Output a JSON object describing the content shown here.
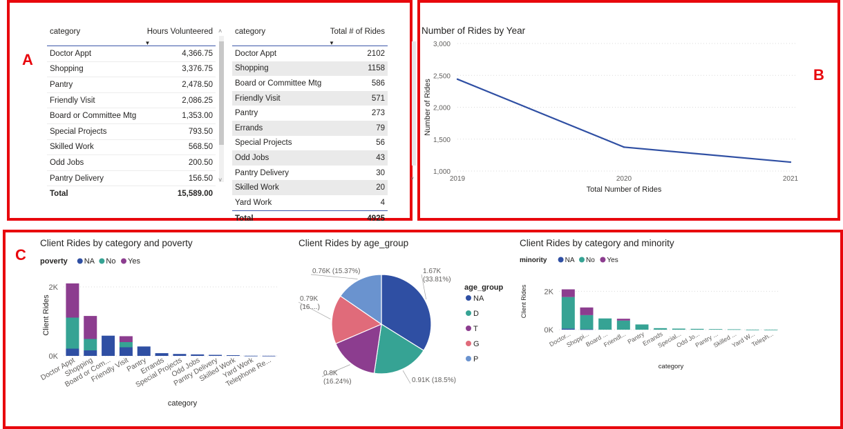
{
  "panels": {
    "a": {
      "letter": "A"
    },
    "b": {
      "letter": "B"
    },
    "c": {
      "letter": "C"
    }
  },
  "hours_table": {
    "col1": "category",
    "col2": "Hours Volunteered",
    "rows": [
      [
        "Doctor Appt",
        "4,366.75"
      ],
      [
        "Shopping",
        "3,376.75"
      ],
      [
        "Pantry",
        "2,478.50"
      ],
      [
        "Friendly Visit",
        "2,086.25"
      ],
      [
        "Board or Committee Mtg",
        "1,353.00"
      ],
      [
        "Special Projects",
        "793.50"
      ],
      [
        "Skilled Work",
        "568.50"
      ],
      [
        "Odd Jobs",
        "200.50"
      ],
      [
        "Pantry Delivery",
        "156.50"
      ]
    ],
    "total_label": "Total",
    "total_value": "15,589.00"
  },
  "rides_table": {
    "col1": "category",
    "col2": "Total # of Rides",
    "rows": [
      [
        "Doctor Appt",
        "2102"
      ],
      [
        "Shopping",
        "1158"
      ],
      [
        "Board or Committee Mtg",
        "586"
      ],
      [
        "Friendly Visit",
        "571"
      ],
      [
        "Pantry",
        "273"
      ],
      [
        "Errands",
        "79"
      ],
      [
        "Special Projects",
        "56"
      ],
      [
        "Odd Jobs",
        "43"
      ],
      [
        "Pantry Delivery",
        "30"
      ],
      [
        "Skilled Work",
        "20"
      ],
      [
        "Yard Work",
        "4"
      ]
    ],
    "total_label": "Total",
    "total_value": "4925"
  },
  "colors": {
    "frame": "#e8070d",
    "NA": "#2f4fa3",
    "No": "#36a394",
    "Yes": "#8c3d8f",
    "T": "#8c3d8f",
    "G": "#e06b7a",
    "P": "#6a93cf"
  },
  "chart_data": [
    {
      "id": "rides_by_year",
      "type": "line",
      "title": "Number of Rides by Year",
      "xlabel": "Total Number of Rides",
      "ylabel": "Number of Rides",
      "x": [
        "2019",
        "2020",
        "2021"
      ],
      "values": [
        2440,
        1375,
        1140
      ],
      "ylim": [
        1000,
        3000
      ],
      "yticks": [
        1000,
        1500,
        2000,
        2500,
        3000
      ],
      "ytick_labels": [
        "1,000",
        "1,500",
        "2,000",
        "2,500",
        "3,000"
      ],
      "color": "#2f4fa3",
      "grid": true
    },
    {
      "id": "rides_by_poverty",
      "type": "bar",
      "stacked": true,
      "title": "Client Rides by category and poverty",
      "legend_title": "poverty",
      "legend_position": "top-left",
      "xlabel": "category",
      "ylabel": "Client Rides",
      "categories": [
        "Doctor Appt",
        "Shopping",
        "Board or Com...",
        "Friendly Visit",
        "Pantry",
        "Errands",
        "Special Projects",
        "Odd Jobs",
        "Pantry Delivery",
        "Skilled Work",
        "Yard Work",
        "Telephone Re..."
      ],
      "series": [
        {
          "name": "NA",
          "values": [
            210,
            160,
            586,
            250,
            273,
            79,
            56,
            43,
            30,
            20,
            4,
            3
          ]
        },
        {
          "name": "No",
          "values": [
            900,
            330,
            0,
            150,
            0,
            0,
            0,
            0,
            0,
            0,
            0,
            0
          ]
        },
        {
          "name": "Yes",
          "values": [
            992,
            668,
            0,
            171,
            0,
            0,
            0,
            0,
            0,
            0,
            0,
            0
          ]
        }
      ],
      "ylim": [
        0,
        2200
      ],
      "yticks": [
        0,
        2000
      ],
      "ytick_labels": [
        "0K",
        "2K"
      ]
    },
    {
      "id": "rides_by_age_group",
      "type": "pie",
      "title": "Client Rides by age_group",
      "legend_title": "age_group",
      "legend_position": "right",
      "slices": [
        {
          "name": "NA",
          "value": 1670,
          "label": "1.67K (33.81%)",
          "label_lines": [
            "1.67K",
            "(33.81%)"
          ]
        },
        {
          "name": "D",
          "value": 910,
          "label": "0.91K (18.5%)",
          "label_lines": [
            "0.91K (18.5%)"
          ]
        },
        {
          "name": "T",
          "value": 800,
          "label": "0.8K (16.24%)",
          "label_lines": [
            "0.8K",
            "(16.24%)"
          ]
        },
        {
          "name": "G",
          "value": 790,
          "label": "0.79K (16....)",
          "label_lines": [
            "0.79K",
            "(16....)"
          ]
        },
        {
          "name": "P",
          "value": 760,
          "label": "0.76K (15.37%)",
          "label_lines": [
            "0.76K (15.37%)"
          ]
        }
      ]
    },
    {
      "id": "rides_by_minority",
      "type": "bar",
      "stacked": true,
      "title": "Client Rides by category and minority",
      "legend_title": "minority",
      "legend_position": "top-left",
      "xlabel": "category",
      "ylabel": "Client Rides",
      "categories": [
        "Doctor...",
        "Shoppi...",
        "Board ...",
        "Friendl...",
        "Pantry",
        "Errands",
        "Special...",
        "Odd Jo...",
        "Pantry ...",
        "Skilled ...",
        "Yard W...",
        "Teleph..."
      ],
      "series": [
        {
          "name": "NA",
          "values": [
            60,
            20,
            0,
            0,
            0,
            0,
            0,
            0,
            0,
            0,
            0,
            0
          ]
        },
        {
          "name": "No",
          "values": [
            1642,
            738,
            586,
            475,
            273,
            79,
            56,
            43,
            30,
            20,
            4,
            3
          ]
        },
        {
          "name": "Yes",
          "values": [
            400,
            400,
            0,
            96,
            0,
            0,
            0,
            0,
            0,
            0,
            0,
            0
          ]
        }
      ],
      "ylim": [
        0,
        2300
      ],
      "yticks": [
        0,
        2000
      ],
      "ytick_labels": [
        "0K",
        "2K"
      ]
    }
  ]
}
